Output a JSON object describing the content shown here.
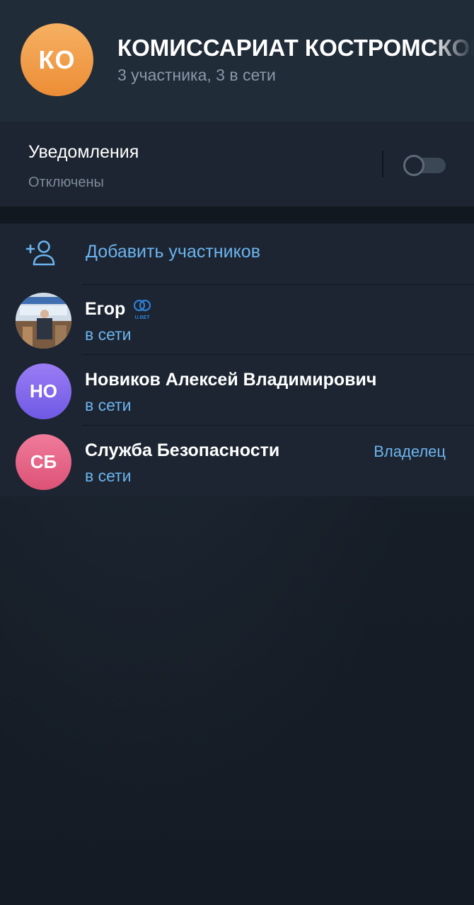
{
  "group": {
    "avatar_initials": "КО",
    "title": "КОМИССАРИАТ КОСТРОМСКОГО",
    "subtitle": "3 участника, 3 в сети"
  },
  "notifications": {
    "label": "Уведомления",
    "status": "Отключены",
    "enabled": false
  },
  "add_members": {
    "label": "Добавить участников",
    "icon": "add-user-icon"
  },
  "members": [
    {
      "name": "Егор",
      "status": "в сети",
      "avatar": "photo",
      "badge_icon": "ubet-logo-icon",
      "role": ""
    },
    {
      "name": "Новиков Алексей Владимирович",
      "status": "в сети",
      "avatar_initials": "НО",
      "role": ""
    },
    {
      "name": "Служба Безопасности",
      "status": "в сети",
      "avatar_initials": "СБ",
      "role": "Владелец"
    }
  ],
  "colors": {
    "accent": "#6cb4ef",
    "header_bg": "#212c39",
    "section_bg": "#1c2531",
    "page_bg": "#161d27",
    "group_avatar": "#f0a04b",
    "avatar_purple": "#8469ee",
    "avatar_pink": "#e6647f"
  }
}
